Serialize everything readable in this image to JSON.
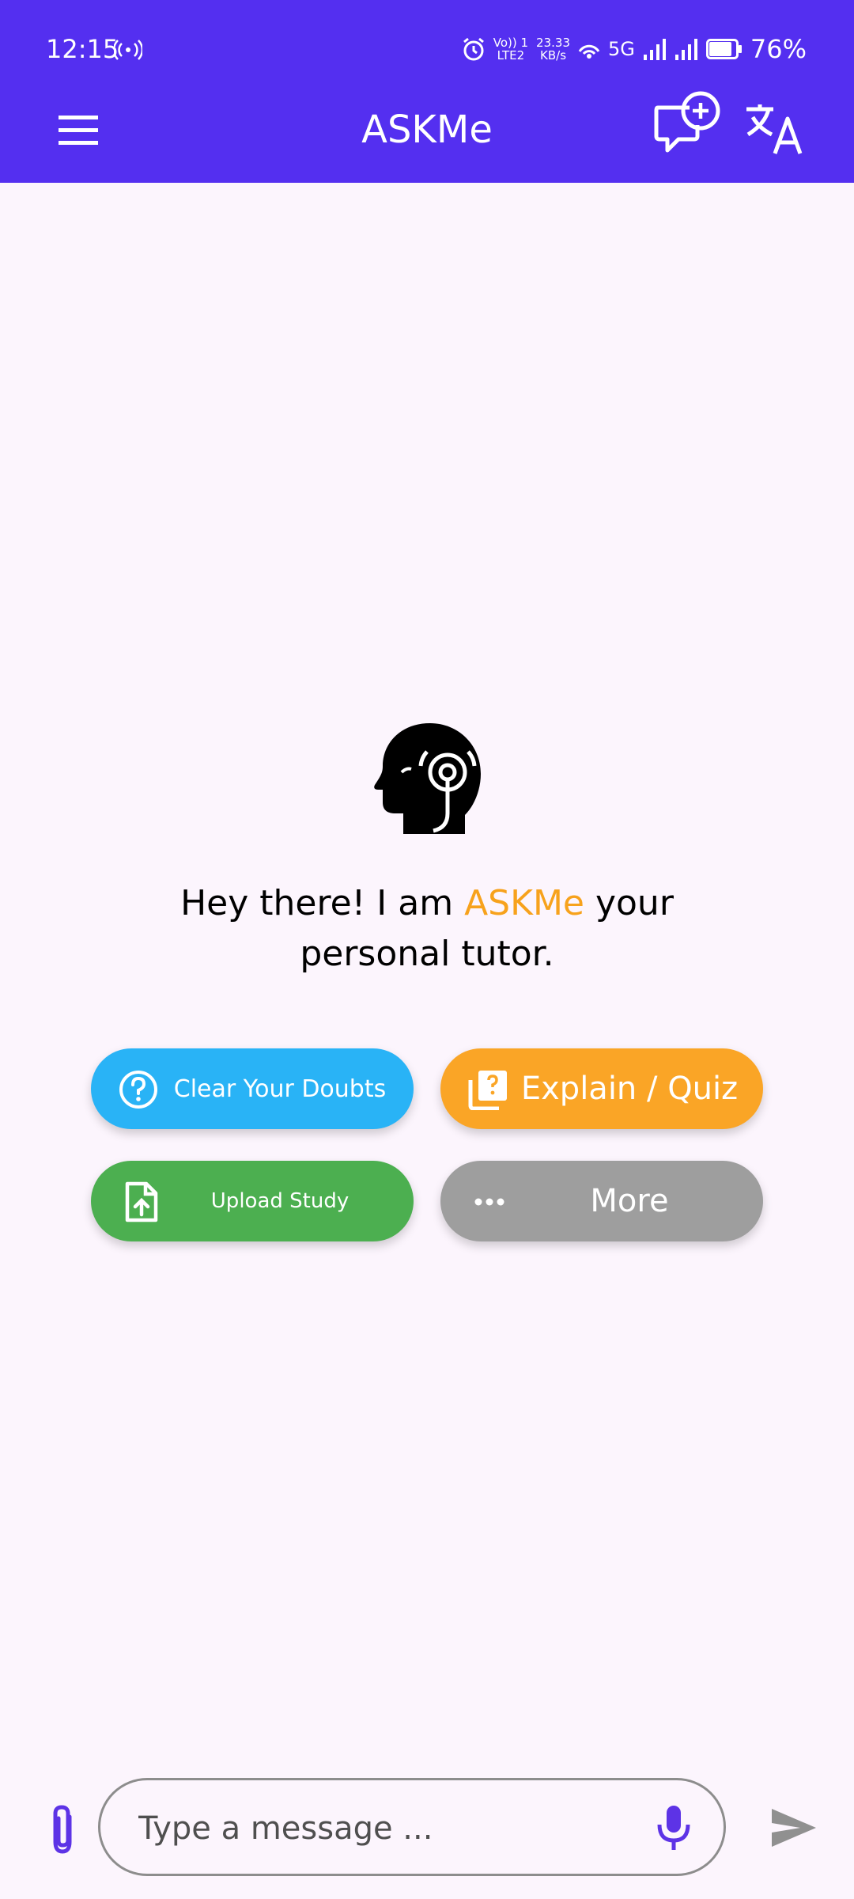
{
  "status_bar": {
    "time": "12:15",
    "volte_line1": "Vo)) 1",
    "volte_line2": "LTE2",
    "speed_line1": "23.33",
    "speed_line2": "KB/s",
    "network": "5G",
    "battery": "76%"
  },
  "app_bar": {
    "title": "ASKMe"
  },
  "greeting": {
    "prefix": "Hey there! I am ",
    "brand": "ASKMe",
    "suffix": " your personal tutor."
  },
  "quick_actions": [
    {
      "label": "Clear Your Doubts",
      "icon": "question-circle-icon",
      "color": "#29b3f6"
    },
    {
      "label": "Explain / Quiz",
      "icon": "quiz-icon",
      "color": "#faa526"
    },
    {
      "label": "Upload Study",
      "icon": "file-upload-icon",
      "color": "#4caf50"
    },
    {
      "label": "More",
      "icon": "more-dots-icon",
      "color": "#9e9e9e"
    }
  ],
  "composer": {
    "placeholder": "Type a message ..."
  },
  "colors": {
    "primary": "#542ff0",
    "accent": "#f7a21c",
    "background": "#fcf5fd"
  }
}
